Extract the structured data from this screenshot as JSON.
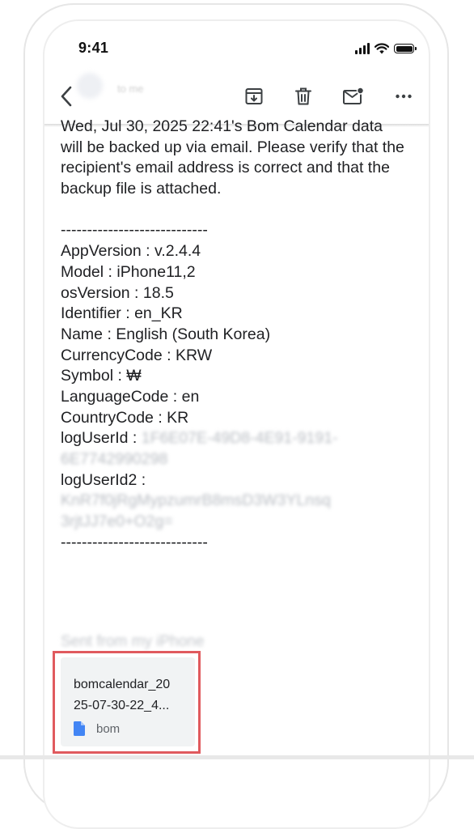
{
  "status_bar": {
    "time": "9:41"
  },
  "toolbar": {
    "to_label": "to me",
    "buttons": [
      "back",
      "archive",
      "delete",
      "mark-unread",
      "more"
    ]
  },
  "email": {
    "first_line_cut": "Wed, Jul 30, 2025 22:41's Bom Calendar data",
    "intro": "will be backed up via email. Please verify that the recipient's email address is correct and that the backup file is attached.",
    "separator": "----------------------------",
    "fields": [
      {
        "key": "AppVersion",
        "value": "v.2.4.4"
      },
      {
        "key": "Model",
        "value": "iPhone11,2"
      },
      {
        "key": "osVersion",
        "value": "18.5"
      },
      {
        "key": "Identifier",
        "value": "en_KR"
      },
      {
        "key": "Name",
        "value": "English (South Korea)"
      },
      {
        "key": "CurrencyCode",
        "value": "KRW"
      },
      {
        "key": "Symbol",
        "value": "₩"
      },
      {
        "key": "LanguageCode",
        "value": "en"
      },
      {
        "key": "CountryCode",
        "value": "KR"
      }
    ],
    "log_user_id_label": "logUserId :",
    "log_user_id_value_1": "1F6E07E-49D8-4E91-9191-",
    "log_user_id_value_2": "6E7742990298",
    "log_user_id2_label": "logUserId2 :",
    "log_user_id2_value_1": "KnR7f0jRgMypzumrB8msD3W3YLnsq",
    "log_user_id2_value_2": "3rjtJJ7e0+O2g=",
    "separator_end": "----------------------------",
    "signature": "Sent from my iPhone"
  },
  "attachment": {
    "name_line1": "bomcalendar_20",
    "name_line2": "25-07-30-22_4...",
    "type": "bom"
  },
  "colors": {
    "highlight": "#e05a5e",
    "file_icon": "#4285f4",
    "card_bg": "#f1f3f4"
  }
}
